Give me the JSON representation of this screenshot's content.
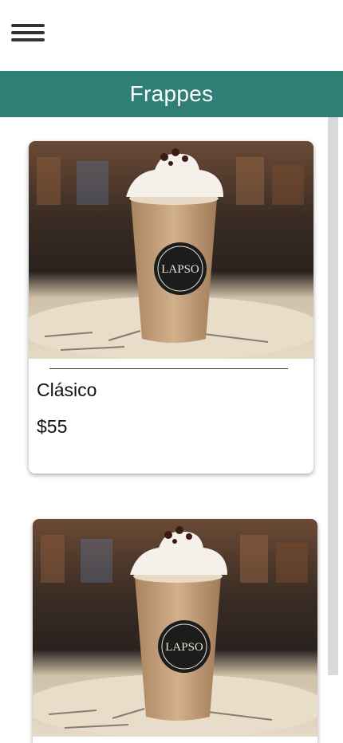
{
  "header": {
    "menu_icon": "hamburger-menu-icon"
  },
  "category": {
    "title": "Frappes"
  },
  "colors": {
    "title_bar": "#2f7f76",
    "background": "#ffffff",
    "cup": "#c9a27c",
    "cream": "#f5f1ea",
    "logo_badge": "#1c1c1c"
  },
  "products": [
    {
      "name": "Clásico",
      "price": "$55",
      "image_icon": "frappe-photo",
      "logo_text": "LAPSO"
    },
    {
      "image_icon": "frappe-photo",
      "logo_text": "LAPSO"
    }
  ]
}
